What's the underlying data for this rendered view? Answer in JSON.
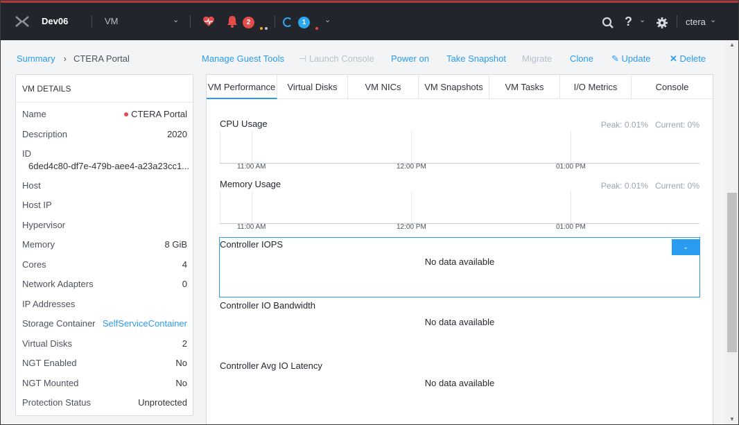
{
  "topbar": {
    "cluster_name": "Dev06",
    "view_name": "VM",
    "alerts_count": "2",
    "tasks_count": "1",
    "user_name": "ctera"
  },
  "breadcrumb": {
    "root": "Summary",
    "current": "CTERA Portal"
  },
  "actions": {
    "manage_guest_tools": "Manage Guest Tools",
    "launch_console": "Launch Console",
    "power_on": "Power on",
    "take_snapshot": "Take Snapshot",
    "migrate": "Migrate",
    "clone": "Clone",
    "update": "Update",
    "delete": "Delete"
  },
  "details": {
    "title": "VM DETAILS",
    "rows": [
      {
        "label": "Name",
        "value": "CTERA Portal"
      },
      {
        "label": "Description",
        "value": "2020"
      },
      {
        "label": "ID",
        "value": "6ded4c80-df7e-479b-aee4-a23a23cc1..."
      },
      {
        "label": "Host",
        "value": ""
      },
      {
        "label": "Host IP",
        "value": ""
      },
      {
        "label": "Hypervisor",
        "value": ""
      },
      {
        "label": "Memory",
        "value": "8 GiB"
      },
      {
        "label": "Cores",
        "value": "4"
      },
      {
        "label": "Network Adapters",
        "value": "0"
      },
      {
        "label": "IP Addresses",
        "value": ""
      },
      {
        "label": "Storage Container",
        "value": "SelfServiceContainer"
      },
      {
        "label": "Virtual Disks",
        "value": "2"
      },
      {
        "label": "NGT Enabled",
        "value": "No"
      },
      {
        "label": "NGT Mounted",
        "value": "No"
      },
      {
        "label": "Protection Status",
        "value": "Unprotected"
      }
    ]
  },
  "tabs": [
    "VM Performance",
    "Virtual Disks",
    "VM NICs",
    "VM Snapshots",
    "VM Tasks",
    "I/O Metrics",
    "Console"
  ],
  "metrics": {
    "cpu": {
      "title": "CPU Usage",
      "peak": "Peak: 0.01%",
      "current": "Current: 0%"
    },
    "memory": {
      "title": "Memory Usage",
      "peak": "Peak: 0.01%",
      "current": "Current: 0%"
    },
    "time_ticks": [
      "11:00 AM",
      "12:00 PM",
      "01:00 PM"
    ],
    "iops": {
      "title": "Controller IOPS",
      "empty": "No data available"
    },
    "bandwidth": {
      "title": "Controller IO Bandwidth",
      "empty": "No data available"
    },
    "latency": {
      "title": "Controller Avg IO Latency",
      "empty": "No data available"
    }
  },
  "colors": {
    "topbar": "#22262c",
    "accent": "#2a9cf0",
    "alert": "#e24c4b",
    "disabled": "#b8c2cc"
  }
}
